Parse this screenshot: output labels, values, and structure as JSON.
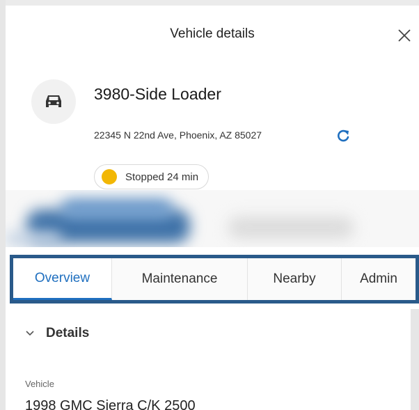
{
  "header": {
    "title": "Vehicle details"
  },
  "vehicle": {
    "name": "3980-Side Loader",
    "address": "22345 N 22nd Ave, Phoenix, AZ 85027",
    "status": "Stopped 24 min",
    "status_color": "#f2b705"
  },
  "tabs": [
    {
      "label": "Overview",
      "active": true
    },
    {
      "label": "Maintenance",
      "active": false
    },
    {
      "label": "Nearby",
      "active": false
    },
    {
      "label": "Admin",
      "active": false
    }
  ],
  "details": {
    "title": "Details",
    "field_label": "Vehicle",
    "field_value": "1998 GMC Sierra C/K 2500"
  },
  "colors": {
    "accent": "#1f6fbf",
    "highlight_border": "#2a5a8a"
  },
  "icons": {
    "close": "close-icon",
    "vehicle": "car-icon",
    "refresh": "refresh-icon",
    "chevron": "chevron-down-icon"
  }
}
